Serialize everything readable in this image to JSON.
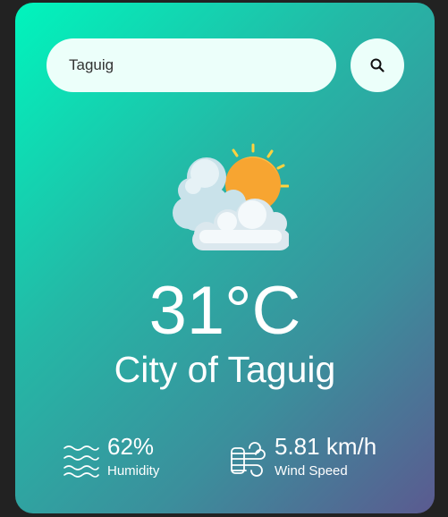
{
  "search": {
    "value": "Taguig",
    "icon": "search-icon"
  },
  "weather": {
    "icon": "partly-cloudy-sun-icon",
    "temperature": "31°C",
    "city": "City of Taguig"
  },
  "details": {
    "humidity": {
      "value": "62%",
      "label": "Humidity",
      "icon": "humidity-waves-icon"
    },
    "wind": {
      "value": "5.81 km/h",
      "label": "Wind Speed",
      "icon": "wind-icon"
    }
  },
  "colors": {
    "gradient_start": "#00f5bd",
    "gradient_mid": "#3b8f9c",
    "gradient_end": "#5b5a90",
    "input_bg": "#ecfffa",
    "sun": "#fbb03b",
    "cloud": "#e8f1f5"
  }
}
